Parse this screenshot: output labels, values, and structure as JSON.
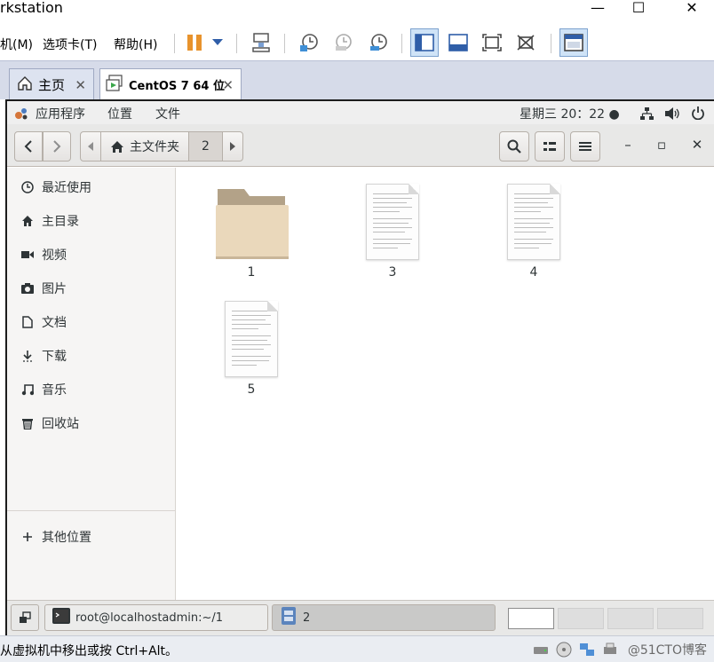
{
  "window": {
    "title": "rkstation",
    "min_glyph": "—",
    "max_glyph": "☐",
    "close_glyph": "✕"
  },
  "menubar": {
    "items": [
      "机(M)",
      "选项卡(T)",
      "帮助(H)"
    ]
  },
  "toolbar": {
    "icons": [
      "pause-icon",
      "dropdown-icon",
      "send-ctrl-alt-del-icon",
      "snapshot-take-icon",
      "snapshot-revert-icon",
      "snapshot-manager-icon",
      "library-view-icon",
      "thumbnail-bar-icon",
      "full-screen-icon",
      "unity-icon",
      "console-view-icon"
    ]
  },
  "tabs": [
    {
      "label": "主页",
      "close": "✕"
    },
    {
      "label": "CentOS 7 64 位",
      "close": "✕"
    }
  ],
  "gnome_topbar": {
    "apps": "应用程序",
    "places": "位置",
    "file": "文件",
    "clock": "星期三 20：22 ●"
  },
  "nautilus": {
    "breadcrumb": {
      "home": "主文件夹",
      "current": "2"
    },
    "wm": {
      "min": "–",
      "max": "▫",
      "close": "✕"
    }
  },
  "sidebar": {
    "items": [
      {
        "label": "最近使用",
        "icon": "recent-icon"
      },
      {
        "label": "主目录",
        "icon": "home-icon"
      },
      {
        "label": "视频",
        "icon": "video-icon"
      },
      {
        "label": "图片",
        "icon": "camera-icon"
      },
      {
        "label": "文档",
        "icon": "document-icon"
      },
      {
        "label": "下载",
        "icon": "download-icon"
      },
      {
        "label": "音乐",
        "icon": "music-icon"
      },
      {
        "label": "回收站",
        "icon": "trash-icon"
      }
    ],
    "other": {
      "label": "其他位置",
      "icon": "plus-icon"
    }
  },
  "files": [
    {
      "name": "1",
      "type": "folder"
    },
    {
      "name": "3",
      "type": "text"
    },
    {
      "name": "4",
      "type": "text"
    },
    {
      "name": "5",
      "type": "text"
    }
  ],
  "bottom_panel": {
    "terminal_task": "root@localhostadmin:~/1",
    "files_task": "2"
  },
  "statusbar": {
    "message": "从虚拟机中移出或按 Ctrl+Alt。",
    "watermark": "@51CTO博客"
  }
}
